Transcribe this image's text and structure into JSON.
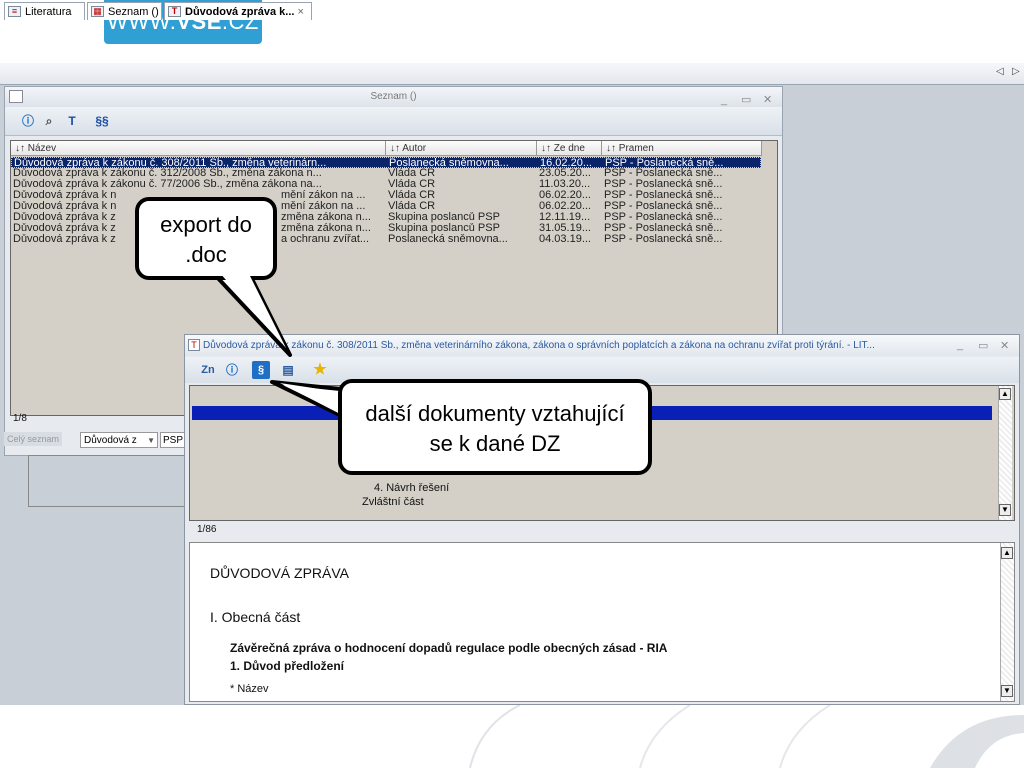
{
  "logo": {
    "prefix": "WWW.",
    "bold": "VSE",
    "suffix": ".CZ"
  },
  "tabs": [
    {
      "label": "Literatura",
      "icon": "list-icon"
    },
    {
      "label": "Seznam ()",
      "icon": "table-icon"
    },
    {
      "label": "Důvodová zpráva k...",
      "icon": "text-doc-icon",
      "close": "×"
    }
  ],
  "nav_arrows": {
    "left": "◁",
    "right": "▷"
  },
  "seznam": {
    "title": "Seznam ()",
    "window_buttons": [
      "_",
      "▭",
      "✕"
    ],
    "toolbar": [
      {
        "name": "info-button",
        "glyph": "ⓘ"
      },
      {
        "name": "search-button",
        "glyph": "🔍"
      },
      {
        "name": "text-button",
        "glyph": "T"
      },
      {
        "name": "paragraphs-button",
        "glyph": "§§"
      }
    ],
    "columns": [
      "↓↑ Název",
      "↓↑ Autor",
      "↓↑ Ze dne",
      "↓↑ Pramen"
    ],
    "rows": [
      [
        "Důvodová zpráva k zákonu č. 308/2011 Sb., změna veterinárn...",
        "Poslanecká sněmovna...",
        "16.02.20...",
        "PSP - Poslanecká sně..."
      ],
      [
        "Důvodová zpráva k zákonu č. 312/2008 Sb., změna zákona n...",
        "Vláda ČR",
        "23.05.20...",
        "PSP - Poslanecká sně..."
      ],
      [
        "Důvodová zpráva k zákonu č. 77/2006 Sb., změna zákona na...",
        "Vláda ČR",
        "11.03.20...",
        "PSP - Poslanecká sně..."
      ],
      [
        "Důvodová zpráva k n",
        "Vláda ČR",
        "06.02.20...",
        "PSP - Poslanecká sně..."
      ],
      [
        "Důvodová zpráva k n",
        "Vláda ČR",
        "06.02.20...",
        "PSP - Poslanecká sně..."
      ],
      [
        "Důvodová zpráva k z",
        "Skupina poslanců PSP",
        "12.11.19...",
        "PSP - Poslanecká sně..."
      ],
      [
        "Důvodová zpráva k z",
        "Skupina poslanců PSP",
        "31.05.19...",
        "PSP - Poslanecká sně..."
      ],
      [
        "Důvodová zpráva k z",
        "Poslanecká sněmovna...",
        "04.03.19...",
        "PSP - Poslanecká sně..."
      ]
    ],
    "row_tails": [
      "",
      "",
      "",
      "mění zákon na ...",
      "mění zákon na ...",
      "změna zákona n...",
      "změna zákona n...",
      "a ochranu zvířat..."
    ],
    "count": "1/8",
    "filter_label": "Celý seznam",
    "filter_value": "Důvodová z",
    "filter_psp": "PSP"
  },
  "detail": {
    "title": "Důvodová zpráva k zákonu č. 308/2011 Sb., změna veterinárního zákona, zákona o správních poplatcích a zákona na ochranu zvířat proti týrání. - LIT...",
    "window_buttons": [
      "_",
      "▭",
      "✕"
    ],
    "toolbar": [
      {
        "name": "zn-button",
        "glyph": "Zn"
      },
      {
        "name": "info-button",
        "glyph": "ⓘ"
      },
      {
        "name": "paragraph-button",
        "glyph": "§"
      },
      {
        "name": "export-doc-button",
        "glyph": "▤"
      },
      {
        "name": "favorite-button",
        "glyph": "★"
      }
    ],
    "toc": [
      "4. Návrh řešení",
      "Zvláštní část"
    ],
    "count": "1/86",
    "heading": "DŮVODOVÁ ZPRÁVA",
    "section": "I. Obecná část",
    "line1": "Závěrečná zpráva o hodnocení dopadů regulace podle obecných zásad - RIA",
    "line2": "1. Důvod předložení",
    "line3": "* Název"
  },
  "callouts": {
    "export": "export do .doc",
    "related": "další dokumenty vztahující se k dané DZ"
  },
  "colors": {
    "selection": "#0a246a",
    "logo": "#2f9fd4"
  }
}
